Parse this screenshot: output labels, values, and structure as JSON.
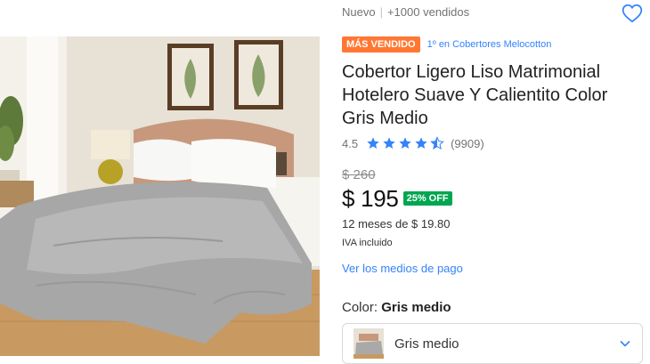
{
  "product_image": {
    "alt": "Cobertor gris sobre cama"
  },
  "header": {
    "condition": "Nuevo",
    "separator": "|",
    "sold": "+1000 vendidos",
    "favorite_icon": "heart-outline-icon"
  },
  "badges": {
    "best_seller": "MÁS VENDIDO",
    "rank": "1º en Cobertores Melocotton"
  },
  "title": "Cobertor Ligero Liso Matrimonial Hotelero Suave Y Calientito Color Gris Medio",
  "rating": {
    "average": "4.5",
    "stars": 4.5,
    "count": "(9909)"
  },
  "pricing": {
    "original": "$ 260",
    "current": "$ 195",
    "discount": "25% OFF",
    "installments": "12 meses de $ 19.80",
    "tax": "IVA incluido"
  },
  "payment_link": "Ver los medios de pago",
  "variant": {
    "label": "Color:",
    "selected": "Gris medio",
    "option_label": "Gris medio"
  },
  "colors": {
    "accent_blue": "#3483fa",
    "best_seller_orange": "#ff7733",
    "discount_green": "#00a650"
  }
}
